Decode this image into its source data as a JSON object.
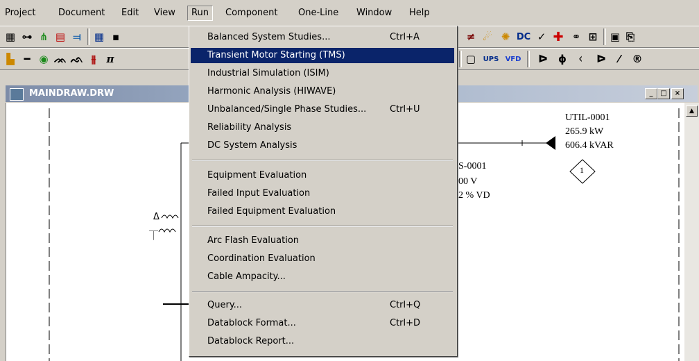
{
  "menubar": {
    "items": [
      {
        "label": "Project"
      },
      {
        "label": "Document"
      },
      {
        "label": "Edit"
      },
      {
        "label": "View"
      },
      {
        "label": "Run"
      },
      {
        "label": "Component"
      },
      {
        "label": "One-Line"
      },
      {
        "label": "Window"
      },
      {
        "label": "Help"
      }
    ]
  },
  "toolbar": {
    "ups_label": "UPS",
    "vfd_label": "VFD",
    "dc_label": "DC"
  },
  "document_window": {
    "title": "MAINDRAW.DRW",
    "min": "_",
    "max": "□",
    "close": "×"
  },
  "drawing": {
    "util_name": "UTIL-0001",
    "util_kw": "265.9 kW",
    "util_kvar": "606.4 kVAR",
    "util_marker": "1",
    "bus_name": "S-0001",
    "bus_voltage": "00 V",
    "bus_vd": "2 % VD"
  },
  "run_menu": {
    "items": [
      {
        "label": "Balanced System Studies...",
        "shortcut": "Ctrl+A"
      },
      {
        "label": "Transient Motor Starting (TMS)",
        "shortcut": ""
      },
      {
        "label": "Industrial Simulation (ISIM)",
        "shortcut": ""
      },
      {
        "label": "Harmonic Analysis (HIWAVE)",
        "shortcut": ""
      },
      {
        "label": "Unbalanced/Single Phase Studies...",
        "shortcut": "Ctrl+U"
      },
      {
        "label": "Reliability Analysis",
        "shortcut": ""
      },
      {
        "label": "DC System Analysis",
        "shortcut": ""
      },
      {
        "label": "Equipment Evaluation",
        "shortcut": ""
      },
      {
        "label": "Failed Input Evaluation",
        "shortcut": ""
      },
      {
        "label": "Failed Equipment Evaluation",
        "shortcut": ""
      },
      {
        "label": "Arc Flash Evaluation",
        "shortcut": ""
      },
      {
        "label": "Coordination Evaluation",
        "shortcut": ""
      },
      {
        "label": "Cable Ampacity...",
        "shortcut": ""
      },
      {
        "label": "Query...",
        "shortcut": "Ctrl+Q"
      },
      {
        "label": "Datablock Format...",
        "shortcut": "Ctrl+D"
      },
      {
        "label": "Datablock Report...",
        "shortcut": ""
      }
    ],
    "highlighted": "Transient Motor Starting (TMS)"
  },
  "colors": {
    "highlight": "#0a246a",
    "face": "#d4d0c8"
  }
}
